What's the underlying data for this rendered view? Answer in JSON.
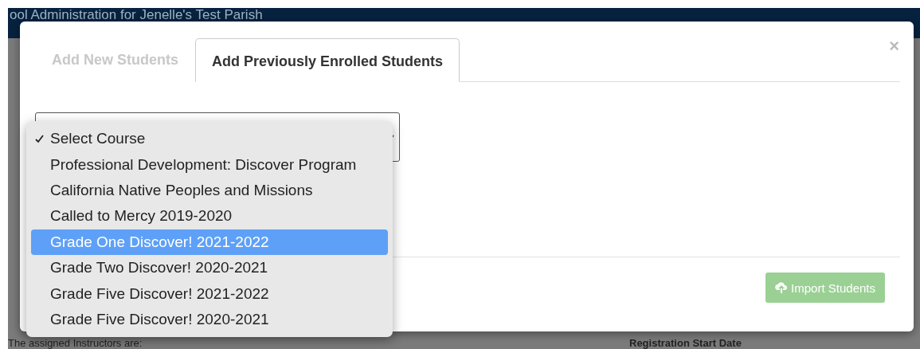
{
  "background_page": {
    "header_title": "ool Administration for Jenelle's Test Parish",
    "texts": [
      "The assigned Instructors are:",
      "Registration Start Date"
    ]
  },
  "modal": {
    "tabs": [
      {
        "label": "Add New Students",
        "selected": false
      },
      {
        "label": "Add Previously Enrolled Students",
        "selected": true
      }
    ],
    "close": "×",
    "course_select": {
      "expanded": true,
      "options": [
        {
          "label": "Select Course",
          "checked": true,
          "selected": false
        },
        {
          "label": "Professional Development: Discover Program",
          "checked": false,
          "selected": false
        },
        {
          "label": "California Native Peoples and Missions",
          "checked": false,
          "selected": false
        },
        {
          "label": "Called to Mercy 2019-2020",
          "checked": false,
          "selected": false
        },
        {
          "label": "Grade One Discover! 2021-2022",
          "checked": false,
          "selected": true
        },
        {
          "label": "Grade Two Discover! 2020-2021",
          "checked": false,
          "selected": false
        },
        {
          "label": "Grade Five Discover! 2021-2022",
          "checked": false,
          "selected": false
        },
        {
          "label": "Grade Five Discover! 2020-2021",
          "checked": false,
          "selected": false
        }
      ]
    },
    "buttons": [
      {
        "label": "Import Students",
        "disabled": true
      }
    ]
  }
}
